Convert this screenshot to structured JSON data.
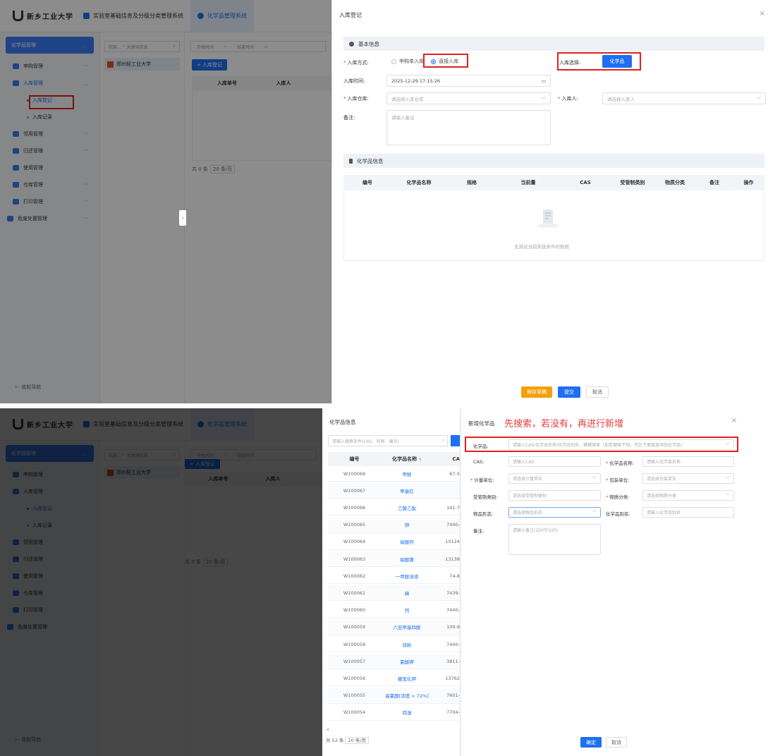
{
  "app": {
    "logo_text": "新乡工业大学",
    "tabs": [
      "实验室基础信息及分级分类管理系统",
      "化学品管理系统"
    ]
  },
  "sidebar": {
    "header": "化学品管理",
    "items": [
      "申购管理",
      "入库管理",
      "入库登记",
      "入库记录",
      "领用管理",
      "归还管理",
      "使用管理",
      "仓库管理",
      "打印管理",
      "危废处置管理"
    ],
    "collapse": "收起导航"
  },
  "tree": {
    "search_prefix": "院部...",
    "search_placeholder": "关键词信息",
    "node": "郑州轻工业大学"
  },
  "list": {
    "start_time": "开始时间",
    "sep": "~",
    "end_time": "结束时间",
    "add_button": "+ 入库登记",
    "col_no": "入库单号",
    "col_person": "入库人",
    "total": "共 0 条",
    "page_size": "20 条/页"
  },
  "drawer": {
    "title": "入库登记",
    "close": "×",
    "section_basic": "基本信息",
    "mode_label": "入库方式:",
    "mode_option1": "申购单入库",
    "mode_option2": "直接入库",
    "select_label": "入库选择:",
    "select_button": "化学品",
    "time_label": "入库时间:",
    "time_value": "2025-12-29 17:15:26",
    "warehouse_label": "入库仓库:",
    "warehouse_placeholder": "请选择入库仓库",
    "person_label": "入库人:",
    "person_placeholder": "请选择入库人",
    "remark_label": "备注:",
    "remark_placeholder": "请输入备注",
    "section_chem": "化学品信息",
    "columns": [
      "编号",
      "化学品名称",
      "规格",
      "当前量",
      "CAS",
      "受管制类别",
      "物质分类",
      "备注",
      "操作"
    ],
    "empty_text": "无满足当前筛选条件的数据",
    "save_draft": "保存草稿",
    "submit": "提交",
    "cancel": "取消"
  },
  "chem_panel": {
    "title": "化学品信息",
    "search_placeholder": "请输入搜索条件(CAS、名称、编号)",
    "col_no": "编号",
    "col_name": "化学品名称",
    "col_cas": "CA",
    "rows": [
      {
        "no": "W100069",
        "name": "甲醇",
        "cas": "67-5"
      },
      {
        "no": "W100067",
        "name": "甲基红",
        "cas": ""
      },
      {
        "no": "W100066",
        "name": "乙酸乙酯",
        "cas": "141-7"
      },
      {
        "no": "W100065",
        "name": "钾",
        "cas": "7440-"
      },
      {
        "no": "W100064",
        "name": "硝酸钙",
        "cas": "10124"
      },
      {
        "no": "W100063",
        "name": "硝酸镍",
        "cas": "13138"
      },
      {
        "no": "W100062",
        "name": "一甲胺溶液",
        "cas": "74-8"
      },
      {
        "no": "W100061",
        "name": "碘",
        "cas": "7439-"
      },
      {
        "no": "W100060",
        "name": "钙",
        "cas": "7440-"
      },
      {
        "no": "W100059",
        "name": "六亚甲基四胺",
        "cas": "100-9"
      },
      {
        "no": "W100058",
        "name": "锌粉",
        "cas": "7440-"
      },
      {
        "no": "W100057",
        "name": "氯酸钾",
        "cas": "3811-"
      },
      {
        "no": "W100056",
        "name": "硼氢化钾",
        "cas": "13762"
      },
      {
        "no": "W100055",
        "name": "高氯酸[浓度 > 72%]",
        "cas": "7601-"
      },
      {
        "no": "W100054",
        "name": "四溴",
        "cas": "7704-"
      }
    ],
    "total": "共 52 条",
    "page_size": "20 条/页"
  },
  "new_dialog": {
    "title": "新增化学品",
    "hint": "先搜索，若没有，再进行新增",
    "close": "×",
    "chem_label": "化学品:",
    "chem_placeholder": "请输入CAS/化学品名称/化学品别名，模糊搜索（如若搜索不到，可在下面直接添加化学品）",
    "cas_label": "CAS:",
    "cas_placeholder": "请输入CAS",
    "name_label": "化学品名称:",
    "name_placeholder": "请输入化学品名称",
    "unit_label": "计量单位:",
    "unit_placeholder": "请选择计量单位",
    "pack_label": "包装单位:",
    "pack_placeholder": "请选择包装单位",
    "ctrl_label": "受管制类别:",
    "ctrl_placeholder": "请选择受管制类别",
    "class_label": "物质分类:",
    "class_placeholder": "请选择物质分类",
    "form_label": "物品形态:",
    "form_placeholder": "请选择物品形态",
    "alias_label": "化学品别名:",
    "alias_placeholder": "请输入化学品别名",
    "remark_label": "备注:",
    "remark_placeholder": "请输入备注(250字以内)",
    "ok": "确定",
    "cancel": "取消"
  },
  "colors": {
    "primary": "#1e6ff1",
    "warning": "#f5a00b",
    "danger": "#e02020"
  }
}
